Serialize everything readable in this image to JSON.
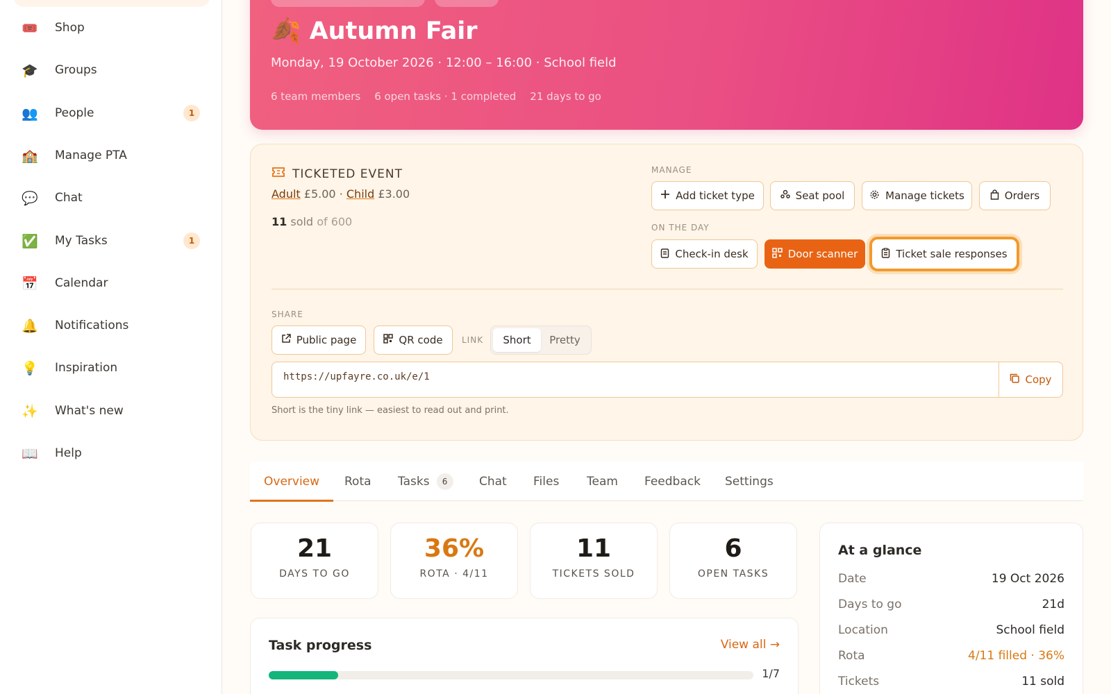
{
  "sidebar": {
    "items": [
      {
        "label": "Shop",
        "icon": "🎟️",
        "icon_name": "ticket-icon"
      },
      {
        "label": "Groups",
        "icon": "🎓",
        "icon_name": "graduation-cap-icon"
      },
      {
        "label": "People",
        "icon": "👥",
        "icon_name": "people-icon",
        "badge": "1"
      },
      {
        "label": "Manage PTA",
        "icon": "🏫",
        "icon_name": "school-icon"
      },
      {
        "label": "Chat",
        "icon": "💬",
        "icon_name": "speech-bubble-icon"
      },
      {
        "label": "My Tasks",
        "icon": "✅",
        "icon_name": "checkmark-icon",
        "badge": "1"
      },
      {
        "label": "Calendar",
        "icon": "📅",
        "icon_name": "calendar-icon"
      },
      {
        "label": "Notifications",
        "icon": "🔔",
        "icon_name": "bell-icon"
      },
      {
        "label": "Inspiration",
        "icon": "💡",
        "icon_name": "lightbulb-icon"
      },
      {
        "label": "What's new",
        "icon": "✨",
        "icon_name": "sparkles-icon"
      },
      {
        "label": "Help",
        "icon": "📖",
        "icon_name": "book-icon"
      }
    ]
  },
  "hero": {
    "emoji": "🍂",
    "title": "Autumn Fair",
    "subtitle": "Monday, 19 October 2026 · 12:00 – 16:00 · School field",
    "meta": {
      "members": "6 team members",
      "tasks": "6 open tasks · 1 completed",
      "countdown": "21 days to go"
    },
    "colors": {
      "start": "#f0607f",
      "end": "#df3286"
    }
  },
  "ticketing": {
    "heading": "TICKETED EVENT",
    "prices": [
      {
        "name": "Adult",
        "price": "£5.00"
      },
      {
        "name": "Child",
        "price": "£3.00"
      }
    ],
    "sold": "11",
    "sold_word": "sold",
    "capacity": "of 600",
    "manage_label": "MANAGE",
    "manage_buttons": {
      "add_ticket_type": "Add ticket type",
      "seat_pool": "Seat pool",
      "manage_tickets": "Manage tickets",
      "orders": "Orders"
    },
    "day_label": "ON THE DAY",
    "day_buttons": {
      "check_in": "Check-in desk",
      "door_scanner": "Door scanner",
      "responses": "Ticket sale responses"
    },
    "share_label": "SHARE",
    "share_buttons": {
      "public_page": "Public page",
      "qr_code": "QR code"
    },
    "link_label": "LINK",
    "link_options": [
      "Short",
      "Pretty"
    ],
    "link_selected": "Short",
    "url": "https://upfayre.co.uk/e/1",
    "copy_label": "Copy",
    "helper_text": "Short is the tiny link — easiest to read out and print."
  },
  "tabs": [
    {
      "label": "Overview",
      "active": true
    },
    {
      "label": "Rota"
    },
    {
      "label": "Tasks",
      "count": "6"
    },
    {
      "label": "Chat"
    },
    {
      "label": "Files"
    },
    {
      "label": "Team"
    },
    {
      "label": "Feedback"
    },
    {
      "label": "Settings"
    }
  ],
  "stats": [
    {
      "value": "21",
      "label": "DAYS TO GO"
    },
    {
      "value": "36%",
      "label": "ROTA · 4/11"
    },
    {
      "value": "11",
      "label": "TICKETS SOLD"
    },
    {
      "value": "6",
      "label": "OPEN TASKS"
    }
  ],
  "task_progress": {
    "title": "Task progress",
    "view_all": "View all →",
    "count": "1/7",
    "fraction": 0.143
  },
  "glance": {
    "title": "At a glance",
    "rows": [
      {
        "key": "Date",
        "value": "19 Oct 2026"
      },
      {
        "key": "Days to go",
        "value": "21d"
      },
      {
        "key": "Location",
        "value": "School field"
      },
      {
        "key": "Rota",
        "value": "4/11 filled · 36%"
      },
      {
        "key": "Tickets",
        "value": "11 sold"
      }
    ]
  },
  "colors": {
    "accent": "#e86414",
    "progress": "#13b57a",
    "badge_bg": "#ffe8cf"
  }
}
